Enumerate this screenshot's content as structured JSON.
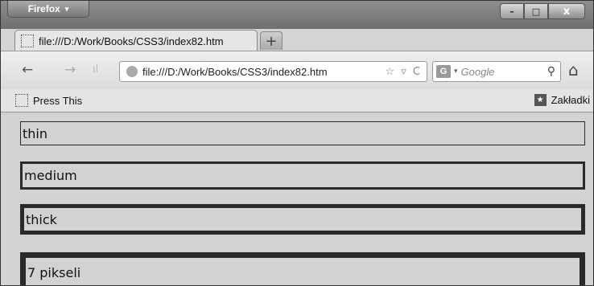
{
  "browser": {
    "menu_label": "Firefox",
    "menu_arrow": "▾",
    "window_controls": {
      "minimize": "–",
      "maximize": "□",
      "close": "x"
    }
  },
  "tabs": [
    {
      "label": "file:///D:/Work/Books/CSS3/index82.htm",
      "icon": "page-icon"
    }
  ],
  "new_tab_label": "+",
  "nav": {
    "back": "←",
    "forward": "→",
    "signal": "ıl",
    "url": "file:///D:/Work/Books/CSS3/index82.htm",
    "url_tools": "☆ ▿ C",
    "search_engine": "G",
    "search_dropdown": "▾",
    "search_placeholder": "Google",
    "search_button": "⚲",
    "home": "⌂"
  },
  "bookmarks": {
    "left_item": "Press This",
    "right_item": "Zakładki",
    "right_icon_glyph": "★"
  },
  "content": {
    "boxes": [
      {
        "label": "thin",
        "border": "thin"
      },
      {
        "label": "medium",
        "border": "medium"
      },
      {
        "label": "thick",
        "border": "thick"
      },
      {
        "label": "7 pikseli",
        "border": "7px"
      }
    ]
  }
}
